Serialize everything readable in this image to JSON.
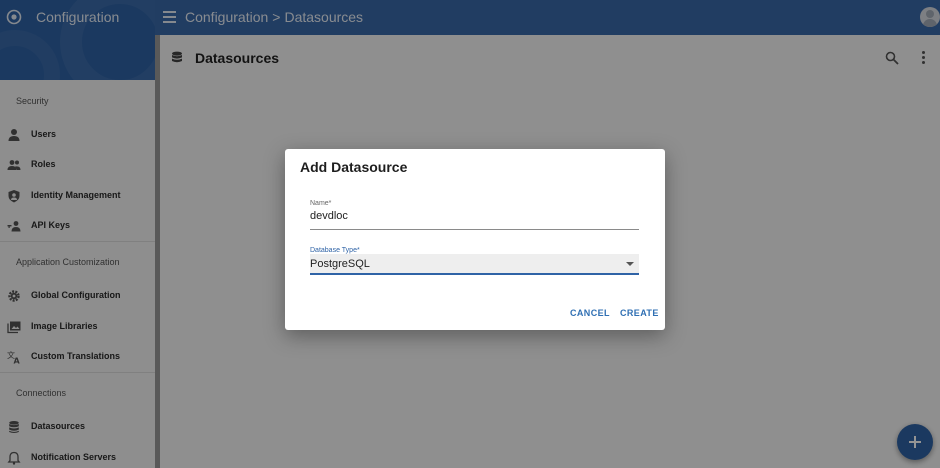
{
  "app": {
    "title": "Configuration"
  },
  "breadcrumb": {
    "root": "Configuration",
    "separator": ">",
    "current": "Datasources"
  },
  "sidebar": {
    "sections": [
      {
        "label": "Security",
        "items": [
          {
            "label": "Users",
            "icon": "person-icon"
          },
          {
            "label": "Roles",
            "icon": "people-icon"
          },
          {
            "label": "Identity Management",
            "icon": "shield-user-icon"
          },
          {
            "label": "API Keys",
            "icon": "key-user-icon"
          }
        ]
      },
      {
        "label": "Application Customization",
        "items": [
          {
            "label": "Global Configuration",
            "icon": "gear-icon"
          },
          {
            "label": "Image Libraries",
            "icon": "image-library-icon"
          },
          {
            "label": "Custom Translations",
            "icon": "translate-icon"
          }
        ]
      },
      {
        "label": "Connections",
        "items": [
          {
            "label": "Datasources",
            "icon": "database-icon"
          },
          {
            "label": "Notification Servers",
            "icon": "bell-icon"
          }
        ]
      }
    ]
  },
  "page": {
    "title": "Datasources"
  },
  "dialog": {
    "title": "Add Datasource",
    "name_field": {
      "label": "Name*",
      "value": "devdloc"
    },
    "type_field": {
      "label": "Database Type*",
      "value": "PostgreSQL"
    },
    "cancel_label": "CANCEL",
    "create_label": "CREATE"
  },
  "colors": {
    "primary": "#2f63a6",
    "appbar": "#3a6aaa",
    "accent_text": "#2f6fb3"
  }
}
